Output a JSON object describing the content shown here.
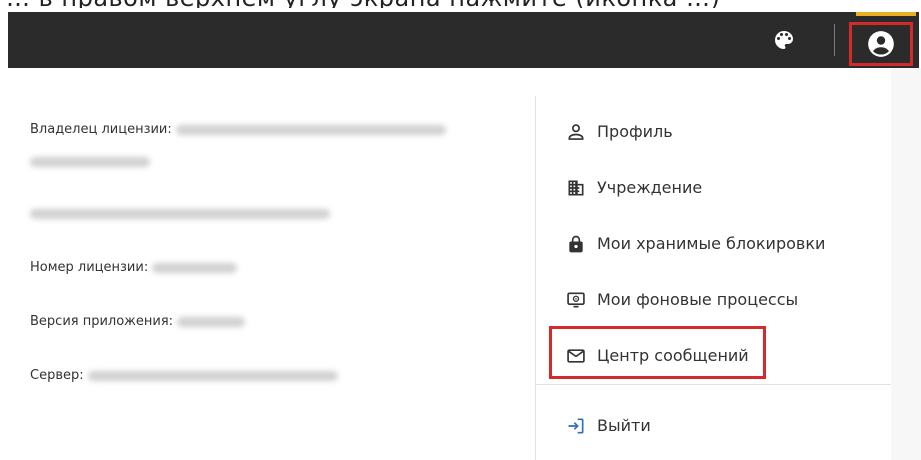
{
  "caption": {
    "cropped_text": "… в правом верхнем углу экрана нажмите (иконка …)"
  },
  "topbar": {
    "theme_icon": "palette-icon",
    "account_icon": "account-circle-icon",
    "colors": {
      "background": "#2b2b2b",
      "accent": "#e8b021",
      "highlight": "#d42a2a"
    }
  },
  "info": {
    "license_owner_label": "Владелец лицензии:",
    "license_number_label": "Номер лицензии:",
    "app_version_label": "Версия приложения:",
    "server_label": "Сервер:"
  },
  "menu": {
    "items": [
      {
        "label": "Профиль",
        "icon": "person-icon"
      },
      {
        "label": "Учреждение",
        "icon": "building-icon"
      },
      {
        "label": "Мои хранимые блокировки",
        "icon": "lock-icon"
      },
      {
        "label": "Мои фоновые процессы",
        "icon": "monitor-icon"
      },
      {
        "label": "Центр сообщений",
        "icon": "mail-icon"
      },
      {
        "label": "Выйти",
        "icon": "logout-icon"
      }
    ]
  }
}
